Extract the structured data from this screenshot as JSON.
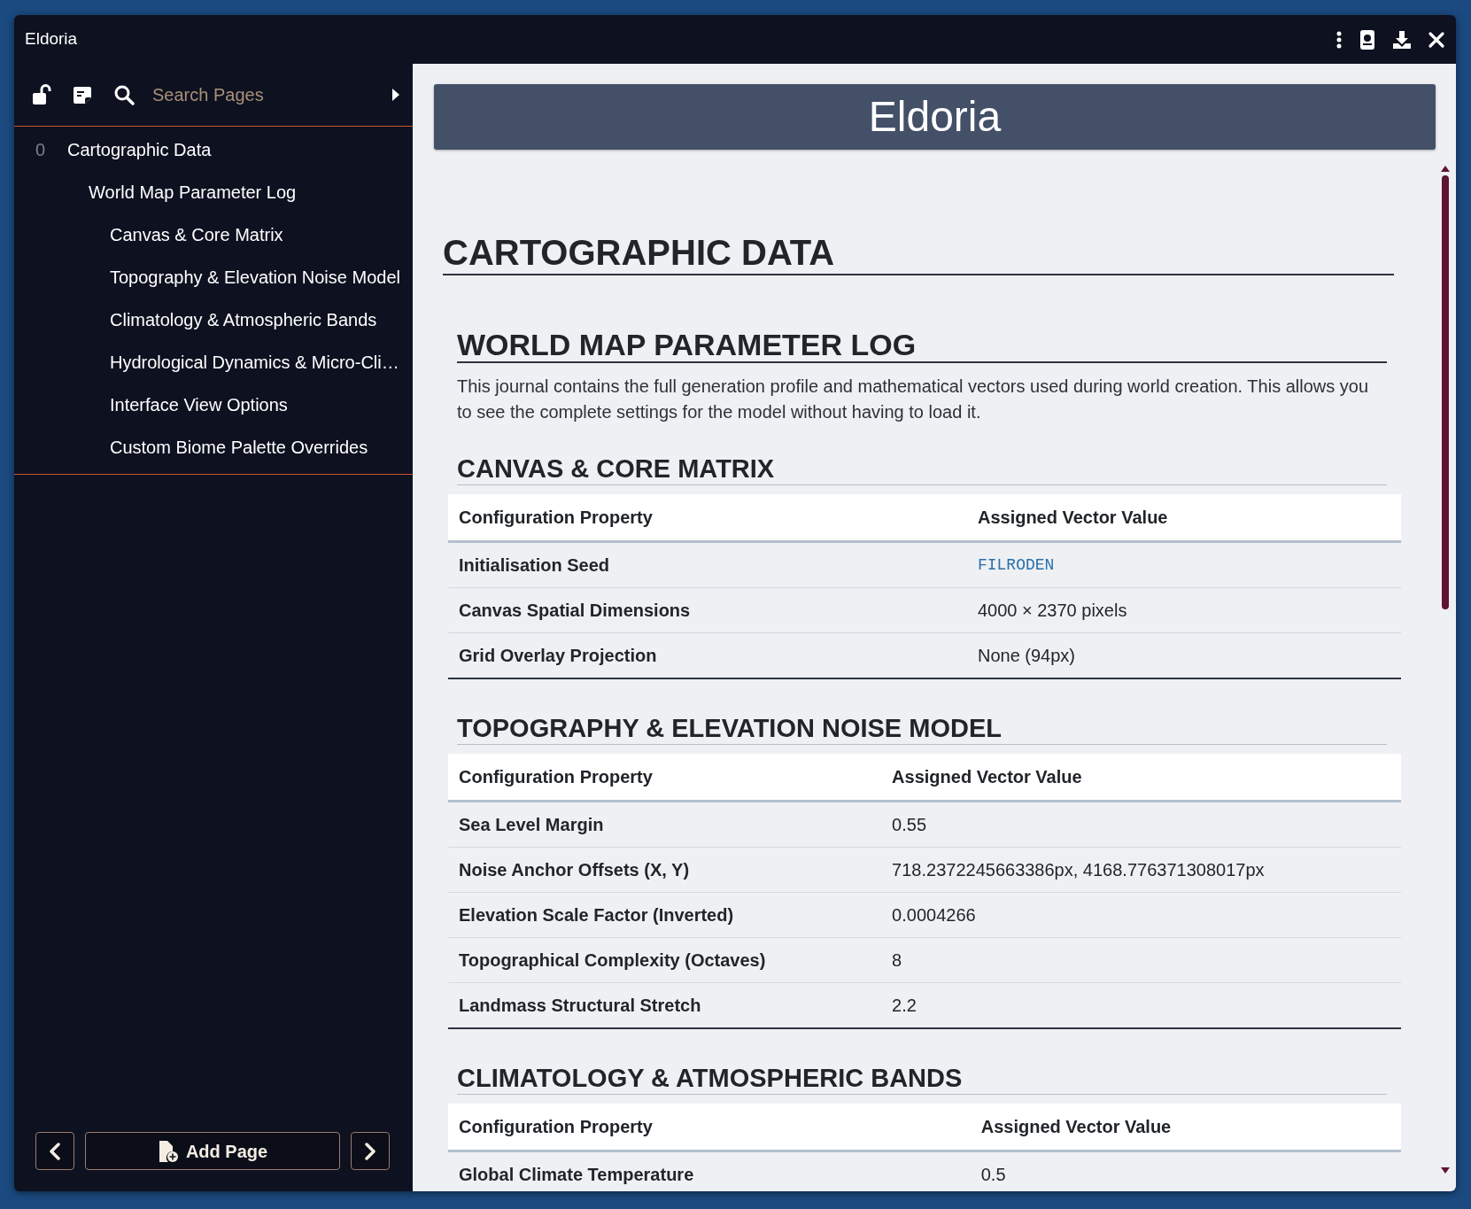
{
  "window": {
    "title": "Eldoria"
  },
  "sidebar": {
    "search": {
      "placeholder": "Search Pages"
    },
    "tree": [
      {
        "number": "0",
        "label": "Cartographic Data",
        "children": [
          {
            "label": "World Map Parameter Log",
            "children": [
              {
                "label": "Canvas & Core Matrix"
              },
              {
                "label": "Topography & Elevation Noise Model"
              },
              {
                "label": "Climatology & Atmospheric Bands"
              },
              {
                "label": "Hydrological Dynamics & Micro-Cli…"
              },
              {
                "label": "Interface View Options"
              },
              {
                "label": "Custom Biome Palette Overrides"
              }
            ]
          }
        ]
      }
    ],
    "add_button": "Add Page"
  },
  "page": {
    "banner": "Eldoria",
    "title": "CARTOGRAPHIC DATA",
    "subtitle": "WORLD MAP PARAMETER LOG",
    "intro": "This journal contains the full generation profile and mathematical vectors used during world creation. This allows you to see the complete settings for the model without having to load it.",
    "sections": [
      {
        "heading": "CANVAS & CORE MATRIX",
        "columns": [
          "Configuration Property",
          "Assigned Vector Value"
        ],
        "rows": [
          {
            "property": "Initialisation Seed",
            "value": "FILRODEN",
            "kind": "code"
          },
          {
            "property": "Canvas Spatial Dimensions",
            "value": "4000 × 2370 pixels",
            "kind": "text"
          },
          {
            "property": "Grid Overlay Projection",
            "value": "None (94px)",
            "kind": "text"
          }
        ]
      },
      {
        "heading": "TOPOGRAPHY & ELEVATION NOISE MODEL",
        "columns": [
          "Configuration Property",
          "Assigned Vector Value"
        ],
        "rows": [
          {
            "property": "Sea Level Margin",
            "value": "0.55",
            "kind": "text"
          },
          {
            "property": "Noise Anchor Offsets (X, Y)",
            "value": "718.2372245663386px, 4168.776371308017px",
            "kind": "text"
          },
          {
            "property": "Elevation Scale Factor (Inverted)",
            "value": "0.0004266",
            "kind": "text"
          },
          {
            "property": "Topographical Complexity (Octaves)",
            "value": "8",
            "kind": "text"
          },
          {
            "property": "Landmass Structural Stretch",
            "value": "2.2",
            "kind": "text"
          }
        ]
      },
      {
        "heading": "CLIMATOLOGY & ATMOSPHERIC BANDS",
        "columns": [
          "Configuration Property",
          "Assigned Vector Value"
        ],
        "rows": [
          {
            "property": "Global Climate Temperature",
            "value": "0.5",
            "kind": "text"
          }
        ]
      }
    ]
  }
}
